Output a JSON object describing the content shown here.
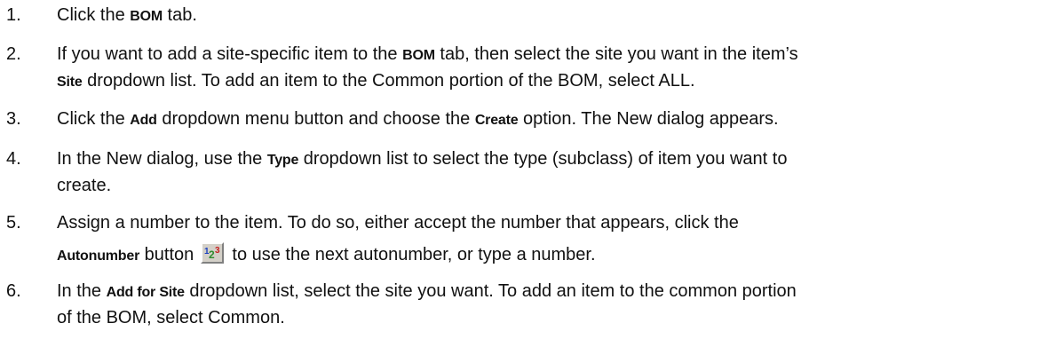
{
  "steps": [
    {
      "number": "1.",
      "lines": [
        [
          {
            "t": "Click the "
          },
          {
            "t": "BOM",
            "ui": true
          },
          {
            "t": " tab."
          }
        ]
      ]
    },
    {
      "number": "2.",
      "lines": [
        [
          {
            "t": "If you want to add a site-specific item to the "
          },
          {
            "t": "BOM",
            "ui": true
          },
          {
            "t": " tab, then select the site you want in the item’s"
          }
        ],
        [
          {
            "t": "Site",
            "ui": true
          },
          {
            "t": " dropdown list. To add an item to the Common portion of the BOM, select ALL."
          }
        ]
      ]
    },
    {
      "number": "3.",
      "lines": [
        [
          {
            "t": "Click the "
          },
          {
            "t": "Add",
            "ui": true
          },
          {
            "t": " dropdown menu button and choose the "
          },
          {
            "t": "Create",
            "ui": true
          },
          {
            "t": " option. The New dialog appears."
          }
        ]
      ]
    },
    {
      "number": "4.",
      "lines": [
        [
          {
            "t": "In the New dialog, use the "
          },
          {
            "t": "Type",
            "ui": true
          },
          {
            "t": " dropdown list to select the type (subclass) of item you want to"
          }
        ],
        [
          {
            "t": "create."
          }
        ]
      ]
    },
    {
      "number": "5.",
      "lines": [
        [
          {
            "t": "Assign a number to the item. To do so, either accept the number that appears, click the"
          }
        ],
        [
          {
            "t": "Autonumber",
            "ui": true
          },
          {
            "t": " button "
          },
          {
            "icon": "autonumber-icon",
            "label": "123"
          },
          {
            "t": " to use the next autonumber, or type a number."
          }
        ]
      ]
    },
    {
      "number": "6.",
      "lines": [
        [
          {
            "t": "In the "
          },
          {
            "t": "Add for Site",
            "ui": true
          },
          {
            "t": " dropdown list, select the site you want. To add an item to the common portion"
          }
        ],
        [
          {
            "t": "of the BOM, select Common."
          }
        ]
      ]
    }
  ]
}
